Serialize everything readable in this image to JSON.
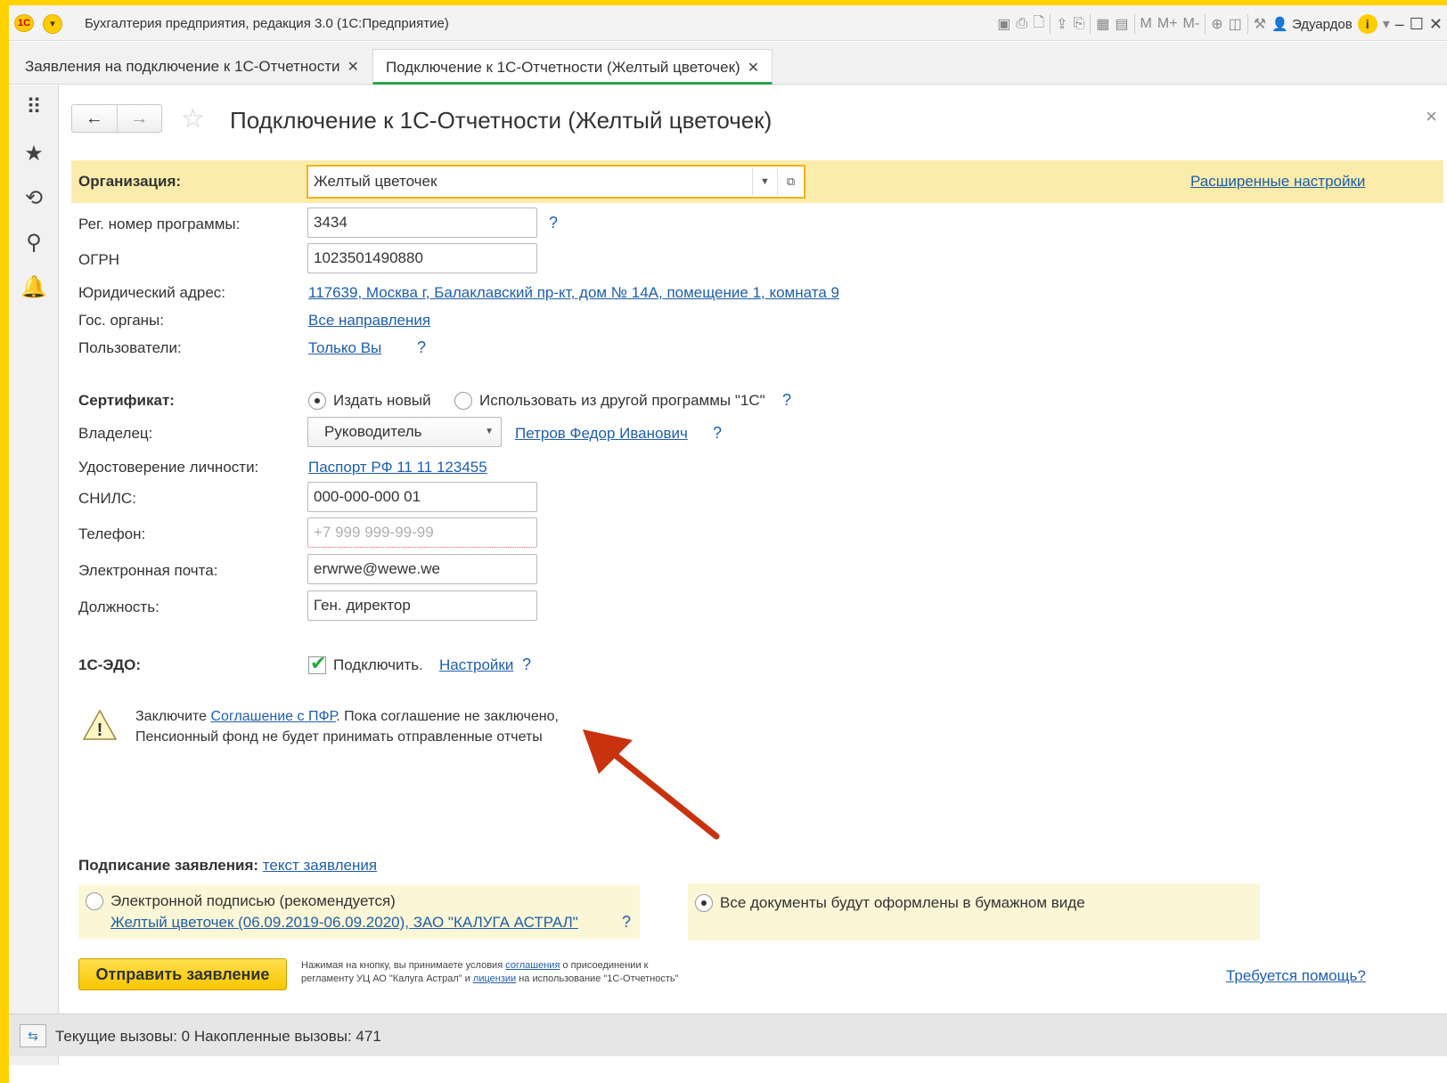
{
  "window": {
    "title": "Бухгалтерия предприятия, редакция 3.0 (1С:Предприятие)",
    "logo": "1С",
    "user": "Эдуардов",
    "memory": [
      "M",
      "M+",
      "M-"
    ]
  },
  "tabs": [
    {
      "label": "Заявления на подключение к 1С-Отчетности",
      "active": false
    },
    {
      "label": "Подключение к 1С-Отчетности (Желтый цветочек)",
      "active": true
    }
  ],
  "form": {
    "title": "Подключение к 1С-Отчетности (Желтый цветочек)",
    "organization": {
      "label": "Организация:",
      "value": "Желтый цветочек",
      "advanced_link": "Расширенные настройки"
    },
    "reg_number": {
      "label": "Рег. номер программы:",
      "value": "3434",
      "help": "?"
    },
    "ogrn": {
      "label": "ОГРН",
      "value": "1023501490880"
    },
    "address": {
      "label": "Юридический адрес:",
      "value": "117639, Москва г, Балаклавский пр-кт, дом № 14А, помещение 1, комната 9"
    },
    "gov": {
      "label": "Гос. органы:",
      "value": "Все направления"
    },
    "users": {
      "label": "Пользователи:",
      "value": "Только Вы",
      "help": "?"
    },
    "certificate": {
      "label": "Сертификат:",
      "option_new": "Издать новый",
      "option_other": "Использовать из другой программы \"1С\"",
      "selected": "new",
      "help": "?"
    },
    "owner": {
      "label": "Владелец:",
      "role": "Руководитель",
      "person": "Петров Федор Иванович",
      "help": "?"
    },
    "identity": {
      "label": "Удостоверение личности:",
      "value": "Паспорт РФ 11 11 123455"
    },
    "snils": {
      "label": "СНИЛС:",
      "value": "000-000-000 01"
    },
    "phone": {
      "label": "Телефон:",
      "placeholder": "+7 999 999-99-99"
    },
    "email": {
      "label": "Электронная почта:",
      "value": "erwrwe@wewe.we"
    },
    "position": {
      "label": "Должность:",
      "value": "Ген. директор"
    },
    "edo": {
      "label": "1С-ЭДО:",
      "checkbox_label": "Подключить.",
      "checked": true,
      "settings_link": "Настройки",
      "help": "?"
    },
    "warning": {
      "line1_prefix": "Заключите",
      "line1_link": "Соглашение с ПФР",
      "line1_suffix": ". Пока соглашение не заключено,",
      "line2": "Пенсионный фонд не будет принимать отправленные отчеты"
    },
    "signing": {
      "label": "Подписание заявления:",
      "text_link": "текст заявления",
      "option_digital": "Электронной подписью (рекомендуется)",
      "digital_cert": "Желтый цветочек (06.09.2019-06.09.2020), ЗАО \"КАЛУГА АСТРАЛ\"",
      "digital_help": "?",
      "option_paper": "Все документы будут оформлены в бумажном виде",
      "selected": "paper"
    },
    "send_button": "Отправить заявление",
    "terms": {
      "p1": "Нажимая на кнопку, вы принимаете условия",
      "link1": "соглашения",
      "p2": "о присоединении к",
      "p3": "регламенту УЦ АО \"Калуга Астрал\" и",
      "link2": "лицензии",
      "p4": "на использование \"1С-Отчетность\""
    },
    "help_link": "Требуется помощь?"
  },
  "statusbar": {
    "text": "Текущие вызовы: 0   Накопленные вызовы: 471"
  },
  "colors": {
    "accent_yellow": "#ffd200",
    "org_row_bg": "#fbecab",
    "link": "#1f5ea8",
    "arrow": "#c8320f"
  }
}
